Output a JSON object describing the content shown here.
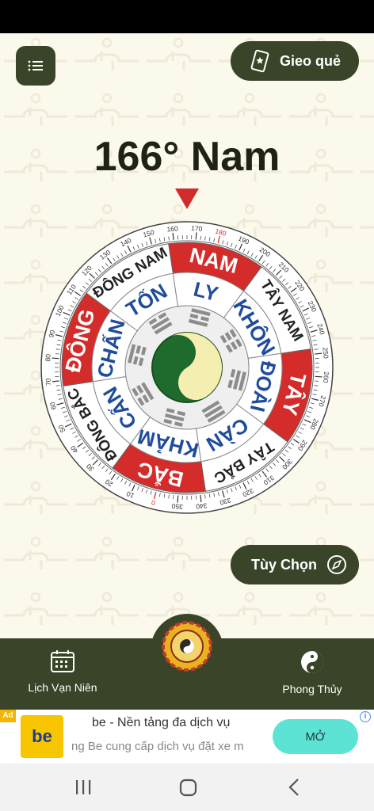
{
  "header": {
    "gieo_label": "Gieo quẻ"
  },
  "compass_reading": {
    "heading_text": "166° Nam",
    "degrees": 166
  },
  "compass": {
    "outer_labels": [
      "NAM",
      "TÂY NAM",
      "TÂY",
      "TÂY BẮC",
      "BẮC",
      "ĐÔNG BẮC",
      "ĐÔNG",
      "ĐÔNG NAM"
    ],
    "inner_labels": [
      "LY",
      "KHÔN",
      "ĐOÀI",
      "CÀN",
      "KHẢM",
      "CẤN",
      "CHẤN",
      "TỐN"
    ],
    "red_color": "#d42b2b",
    "inner_text_color": "#1f4c9c"
  },
  "options": {
    "label": "Tùy Chọn"
  },
  "bottom_nav": {
    "left_label": "Lịch Vạn Niên",
    "right_label": "Phong Thủy"
  },
  "ad": {
    "badge": "Ad",
    "logo_text": "be",
    "title": "be - Nền tảng đa dịch vụ",
    "description": "ng Be cung cấp dịch vụ đặt xe m",
    "cta": "MỞ"
  }
}
